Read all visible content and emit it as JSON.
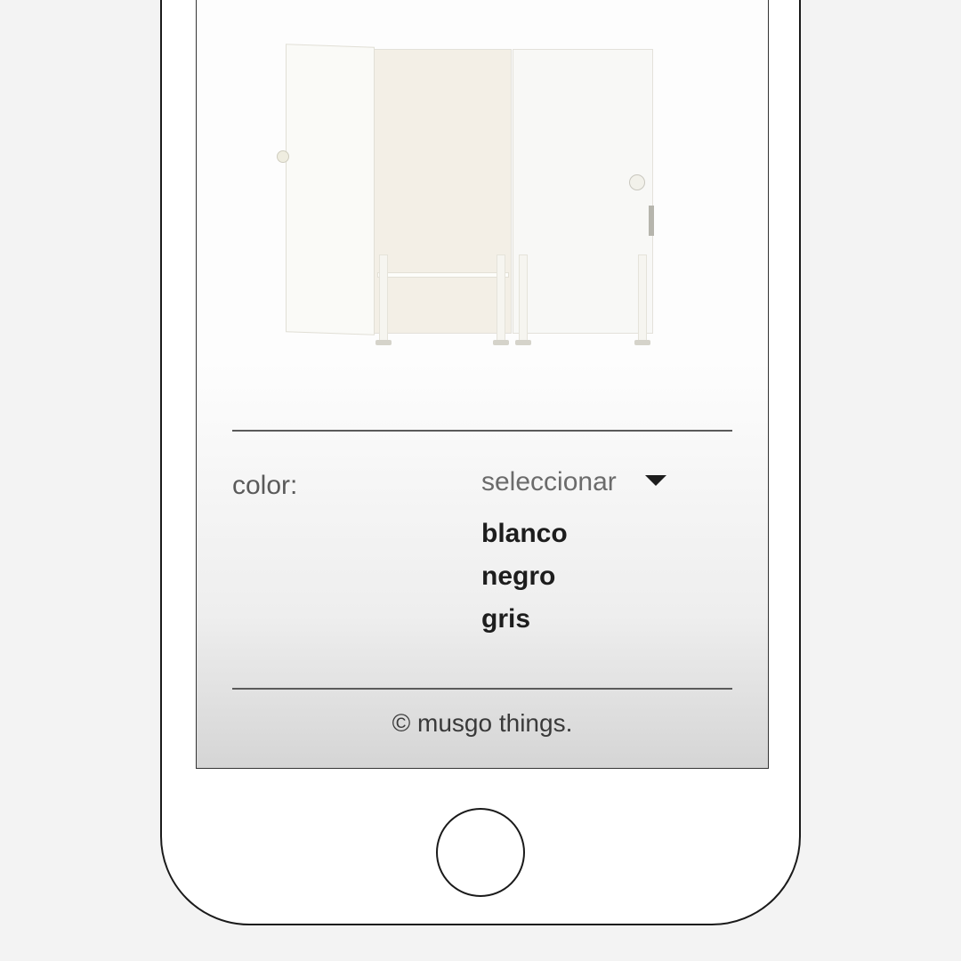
{
  "product": {
    "option_label": "color:",
    "select_placeholder": "seleccionar",
    "options": [
      "blanco",
      "negro",
      "gris"
    ]
  },
  "footer": {
    "copyright": "© musgo things."
  },
  "icons": {
    "chevron_down": "chevron-down-icon"
  }
}
